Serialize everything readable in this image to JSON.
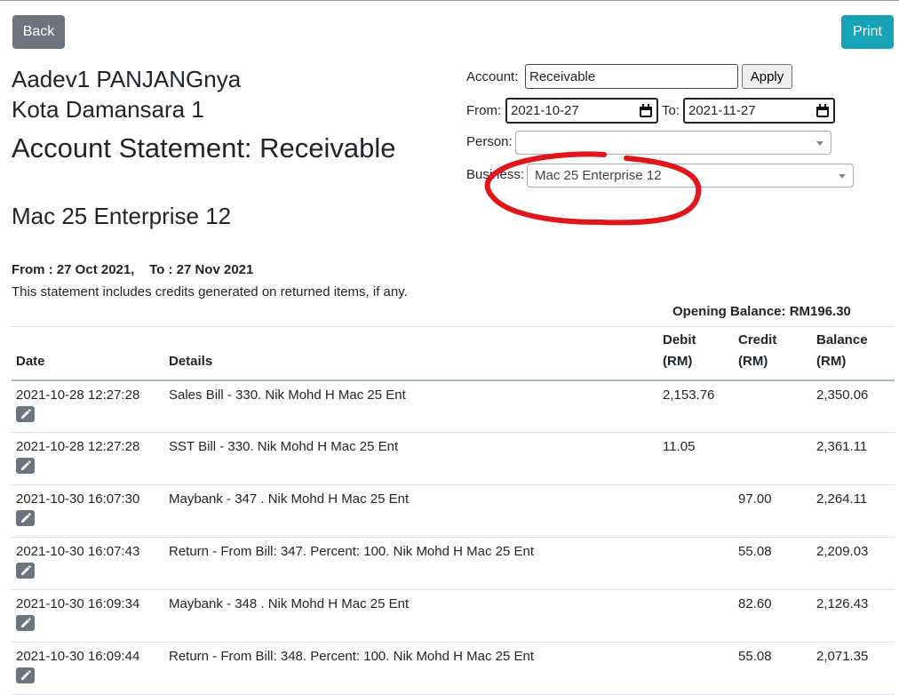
{
  "toolbar": {
    "back_label": "Back",
    "print_label": "Print"
  },
  "company": {
    "name": "Aadev1 PANJANGnya",
    "branch": "Kota Damansara 1"
  },
  "statement_title": "Account Statement: Receivable",
  "business_title": "Mac 25 Enterprise 12",
  "filters": {
    "account_label": "Account:",
    "account_value": "Receivable",
    "apply_label": "Apply",
    "from_label": "From:",
    "from_value": "2021-10-27",
    "to_label": "To:",
    "to_value": "2021-11-27",
    "person_label": "Person:",
    "person_value": "",
    "business_label": "Business:",
    "business_value": "Mac 25 Enterprise 12"
  },
  "range": {
    "from": "From : 27 Oct 2021,",
    "to": "To : 27 Nov 2021"
  },
  "note": "This statement includes credits generated on returned items, if any.",
  "opening_balance": "Opening Balance: RM196.30",
  "annotation_color": "#e0161b",
  "table": {
    "headers": {
      "date": "Date",
      "details": "Details",
      "debit_1": "Debit",
      "debit_2": "(RM)",
      "credit_1": "Credit",
      "credit_2": "(RM)",
      "balance_1": "Balance",
      "balance_2": "(RM)"
    },
    "rows": [
      {
        "date": "2021-10-28 12:27:28",
        "details": "Sales Bill - 330. Nik Mohd H Mac 25 Ent",
        "debit": "2,153.76",
        "credit": "",
        "balance": "2,350.06"
      },
      {
        "date": "2021-10-28 12:27:28",
        "details": "SST Bill - 330. Nik Mohd H Mac 25 Ent",
        "debit": "11.05",
        "credit": "",
        "balance": "2,361.11"
      },
      {
        "date": "2021-10-30 16:07:30",
        "details": "Maybank - 347 . Nik Mohd H Mac 25 Ent",
        "debit": "",
        "credit": "97.00",
        "balance": "2,264.11"
      },
      {
        "date": "2021-10-30 16:07:43",
        "details": "Return - From Bill: 347. Percent: 100. Nik Mohd H Mac 25 Ent",
        "debit": "",
        "credit": "55.08",
        "balance": "2,209.03"
      },
      {
        "date": "2021-10-30 16:09:34",
        "details": "Maybank - 348 . Nik Mohd H Mac 25 Ent",
        "debit": "",
        "credit": "82.60",
        "balance": "2,126.43"
      },
      {
        "date": "2021-10-30 16:09:44",
        "details": "Return - From Bill: 348. Percent: 100. Nik Mohd H Mac 25 Ent",
        "debit": "",
        "credit": "55.08",
        "balance": "2,071.35"
      }
    ]
  }
}
